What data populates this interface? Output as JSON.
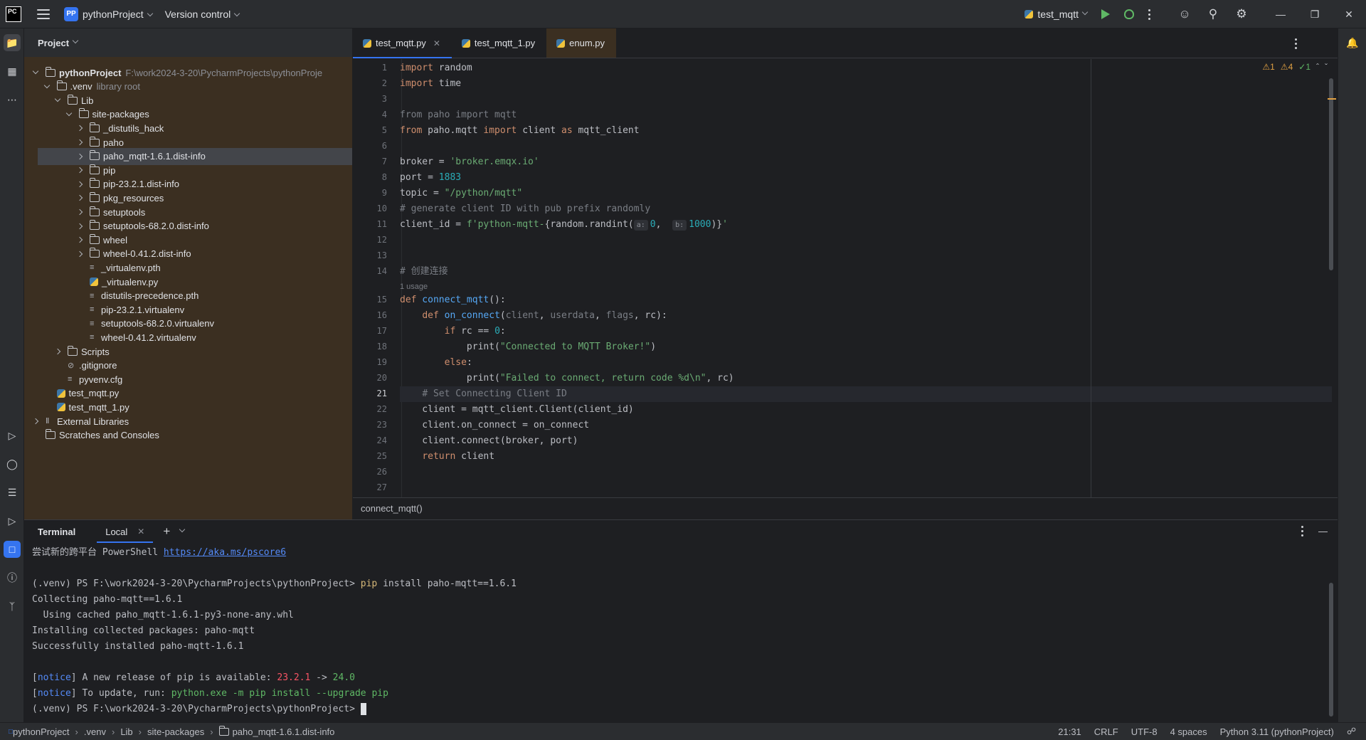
{
  "titlebar": {
    "logo": "PC",
    "project_badge": "PP",
    "project_name": "pythonProject",
    "vcs_label": "Version control",
    "run_config": "test_mqtt"
  },
  "project_panel": {
    "title": "Project",
    "items": [
      {
        "label": "pythonProject",
        "extra": "F:\\work2024-3-20\\PycharmProjects\\pythonProje",
        "kind": "folder",
        "depth": 0,
        "arrow": "down",
        "bold": true
      },
      {
        "label": ".venv",
        "extra": "library root",
        "kind": "folder",
        "depth": 1,
        "arrow": "down"
      },
      {
        "label": "Lib",
        "extra": "",
        "kind": "folder",
        "depth": 2,
        "arrow": "down"
      },
      {
        "label": "site-packages",
        "extra": "",
        "kind": "folder",
        "depth": 3,
        "arrow": "down"
      },
      {
        "label": "_distutils_hack",
        "extra": "",
        "kind": "pkg",
        "depth": 4,
        "arrow": "right"
      },
      {
        "label": "paho",
        "extra": "",
        "kind": "pkg",
        "depth": 4,
        "arrow": "right"
      },
      {
        "label": "paho_mqtt-1.6.1.dist-info",
        "extra": "",
        "kind": "folder",
        "depth": 4,
        "arrow": "right",
        "selected": true
      },
      {
        "label": "pip",
        "extra": "",
        "kind": "pkg",
        "depth": 4,
        "arrow": "right"
      },
      {
        "label": "pip-23.2.1.dist-info",
        "extra": "",
        "kind": "folder",
        "depth": 4,
        "arrow": "right"
      },
      {
        "label": "pkg_resources",
        "extra": "",
        "kind": "pkg",
        "depth": 4,
        "arrow": "right"
      },
      {
        "label": "setuptools",
        "extra": "",
        "kind": "pkg",
        "depth": 4,
        "arrow": "right"
      },
      {
        "label": "setuptools-68.2.0.dist-info",
        "extra": "",
        "kind": "folder",
        "depth": 4,
        "arrow": "right"
      },
      {
        "label": "wheel",
        "extra": "",
        "kind": "pkg",
        "depth": 4,
        "arrow": "right"
      },
      {
        "label": "wheel-0.41.2.dist-info",
        "extra": "",
        "kind": "folder",
        "depth": 4,
        "arrow": "right"
      },
      {
        "label": "_virtualenv.pth",
        "extra": "",
        "kind": "text",
        "depth": 4,
        "arrow": "none"
      },
      {
        "label": "_virtualenv.py",
        "extra": "",
        "kind": "py",
        "depth": 4,
        "arrow": "none"
      },
      {
        "label": "distutils-precedence.pth",
        "extra": "",
        "kind": "text",
        "depth": 4,
        "arrow": "none"
      },
      {
        "label": "pip-23.2.1.virtualenv",
        "extra": "",
        "kind": "text",
        "depth": 4,
        "arrow": "none"
      },
      {
        "label": "setuptools-68.2.0.virtualenv",
        "extra": "",
        "kind": "text",
        "depth": 4,
        "arrow": "none"
      },
      {
        "label": "wheel-0.41.2.virtualenv",
        "extra": "",
        "kind": "text",
        "depth": 4,
        "arrow": "none"
      },
      {
        "label": "Scripts",
        "extra": "",
        "kind": "folder",
        "depth": 2,
        "arrow": "right"
      },
      {
        "label": ".gitignore",
        "extra": "",
        "kind": "ignore",
        "depth": 2,
        "arrow": "none"
      },
      {
        "label": "pyvenv.cfg",
        "extra": "",
        "kind": "text",
        "depth": 2,
        "arrow": "none"
      },
      {
        "label": "test_mqtt.py",
        "extra": "",
        "kind": "py",
        "depth": 1,
        "arrow": "none"
      },
      {
        "label": "test_mqtt_1.py",
        "extra": "",
        "kind": "py",
        "depth": 1,
        "arrow": "none"
      },
      {
        "label": "External Libraries",
        "extra": "",
        "kind": "lib",
        "depth": 0,
        "arrow": "right"
      },
      {
        "label": "Scratches and Consoles",
        "extra": "",
        "kind": "folder",
        "depth": 0,
        "arrow": "none"
      }
    ]
  },
  "editor": {
    "tabs": [
      {
        "label": "test_mqtt.py",
        "active": true,
        "closable": true
      },
      {
        "label": "test_mqtt_1.py",
        "active": false,
        "closable": false
      },
      {
        "label": "enum.py",
        "active": false,
        "closable": false
      }
    ],
    "inspections": {
      "errors": "1",
      "warnings": "4",
      "ok": "1"
    },
    "usage_hint": "1 usage",
    "current_line": 21,
    "breadcrumb": "connect_mqtt()",
    "lines": [
      [
        [
          "kw",
          "import"
        ],
        [
          "p",
          " random"
        ]
      ],
      [
        [
          "kw",
          "import"
        ],
        [
          "p",
          " time"
        ]
      ],
      [],
      [
        [
          "cmt",
          "from paho import mqtt"
        ]
      ],
      [
        [
          "kw",
          "from"
        ],
        [
          "p",
          " paho.mqtt "
        ],
        [
          "kw",
          "import"
        ],
        [
          "p",
          " client "
        ],
        [
          "kw",
          "as"
        ],
        [
          "p",
          " mqtt_client"
        ]
      ],
      [],
      [
        [
          "p",
          "broker = "
        ],
        [
          "str",
          "'broker.emqx.io'"
        ]
      ],
      [
        [
          "p",
          "port = "
        ],
        [
          "num",
          "1883"
        ]
      ],
      [
        [
          "p",
          "topic = "
        ],
        [
          "str",
          "\"/python/mqtt\""
        ]
      ],
      [
        [
          "cmt",
          "# generate client ID with pub prefix randomly"
        ]
      ],
      [
        [
          "p",
          "client_id = "
        ],
        [
          "str",
          "f'python-mqtt-"
        ],
        [
          "p",
          "{random.randint("
        ],
        [
          "hint",
          "a:"
        ],
        [
          "num",
          "0"
        ],
        [
          "p",
          ",  "
        ],
        [
          "hint",
          "b:"
        ],
        [
          "num",
          "1000"
        ],
        [
          "p",
          ")}"
        ],
        [
          "str",
          "'"
        ]
      ],
      [],
      [],
      [
        [
          "cmt",
          "# 创建连接"
        ]
      ],
      [
        [
          "kw",
          "def"
        ],
        [
          "fn",
          " connect_mqtt"
        ],
        [
          "p",
          "():"
        ]
      ],
      [
        [
          "p",
          "    "
        ],
        [
          "kw",
          "def"
        ],
        [
          "fn",
          " on_connect"
        ],
        [
          "p",
          "("
        ],
        [
          "greyp",
          "client"
        ],
        [
          "p",
          ", "
        ],
        [
          "greyp",
          "userdata"
        ],
        [
          "p",
          ", "
        ],
        [
          "greyp",
          "flags"
        ],
        [
          "p",
          ", rc):"
        ]
      ],
      [
        [
          "p",
          "        "
        ],
        [
          "kw",
          "if"
        ],
        [
          "p",
          " rc == "
        ],
        [
          "num",
          "0"
        ],
        [
          "p",
          ":"
        ]
      ],
      [
        [
          "p",
          "            print("
        ],
        [
          "str",
          "\"Connected to MQTT Broker!\""
        ],
        [
          "p",
          ")"
        ]
      ],
      [
        [
          "p",
          "        "
        ],
        [
          "kw",
          "else"
        ],
        [
          "p",
          ":"
        ]
      ],
      [
        [
          "p",
          "            print("
        ],
        [
          "str",
          "\"Failed to connect, return code %d\\n\""
        ],
        [
          "p",
          ", rc)"
        ]
      ],
      [
        [
          "p",
          "    "
        ],
        [
          "cmt",
          "# Set Connecting Client ID"
        ]
      ],
      [
        [
          "p",
          "    client = mqtt_client.Client(client_id)"
        ]
      ],
      [
        [
          "p",
          "    client.on_connect = on_connect"
        ]
      ],
      [
        [
          "p",
          "    client.connect(broker, port)"
        ]
      ],
      [
        [
          "p",
          "    "
        ],
        [
          "kw",
          "return"
        ],
        [
          "p",
          " client"
        ]
      ],
      [],
      []
    ]
  },
  "terminal": {
    "title": "Terminal",
    "tab": "Local",
    "lines": [
      [
        [
          "p",
          "尝试新的跨平台 PowerShell "
        ],
        [
          "link",
          "https://aka.ms/pscore6"
        ]
      ],
      [],
      [
        [
          "p",
          "(.venv) PS F:\\work2024-3-20\\PycharmProjects\\pythonProject> "
        ],
        [
          "yellow",
          "pip"
        ],
        [
          "p",
          " install paho-mqtt==1.6.1"
        ]
      ],
      [
        [
          "p",
          "Collecting paho-mqtt==1.6.1"
        ]
      ],
      [
        [
          "p",
          "  Using cached paho_mqtt-1.6.1-py3-none-any.whl"
        ]
      ],
      [
        [
          "p",
          "Installing collected packages: paho-mqtt"
        ]
      ],
      [
        [
          "p",
          "Successfully installed paho-mqtt-1.6.1"
        ]
      ],
      [],
      [
        [
          "p",
          "["
        ],
        [
          "blue",
          "notice"
        ],
        [
          "p",
          "] A new release of pip is available: "
        ],
        [
          "red",
          "23.2.1"
        ],
        [
          "p",
          " -> "
        ],
        [
          "green",
          "24.0"
        ]
      ],
      [
        [
          "p",
          "["
        ],
        [
          "blue",
          "notice"
        ],
        [
          "p",
          "] To update, run: "
        ],
        [
          "green",
          "python.exe -m pip install --upgrade pip"
        ]
      ],
      [
        [
          "p",
          "(.venv) PS F:\\work2024-3-20\\PycharmProjects\\pythonProject> "
        ],
        [
          "cursor",
          ""
        ]
      ]
    ]
  },
  "statusbar": {
    "crumbs": [
      "pythonProject",
      ".venv",
      "Lib",
      "site-packages",
      "paho_mqtt-1.6.1.dist-info"
    ],
    "position": "21:31",
    "line_sep": "CRLF",
    "encoding": "UTF-8",
    "indent": "4 spaces",
    "interpreter": "Python 3.11 (pythonProject)"
  },
  "colors": {
    "accent": "#3574f0",
    "panel_bg": "#3b2f21",
    "editor_bg": "#1e1f22"
  }
}
